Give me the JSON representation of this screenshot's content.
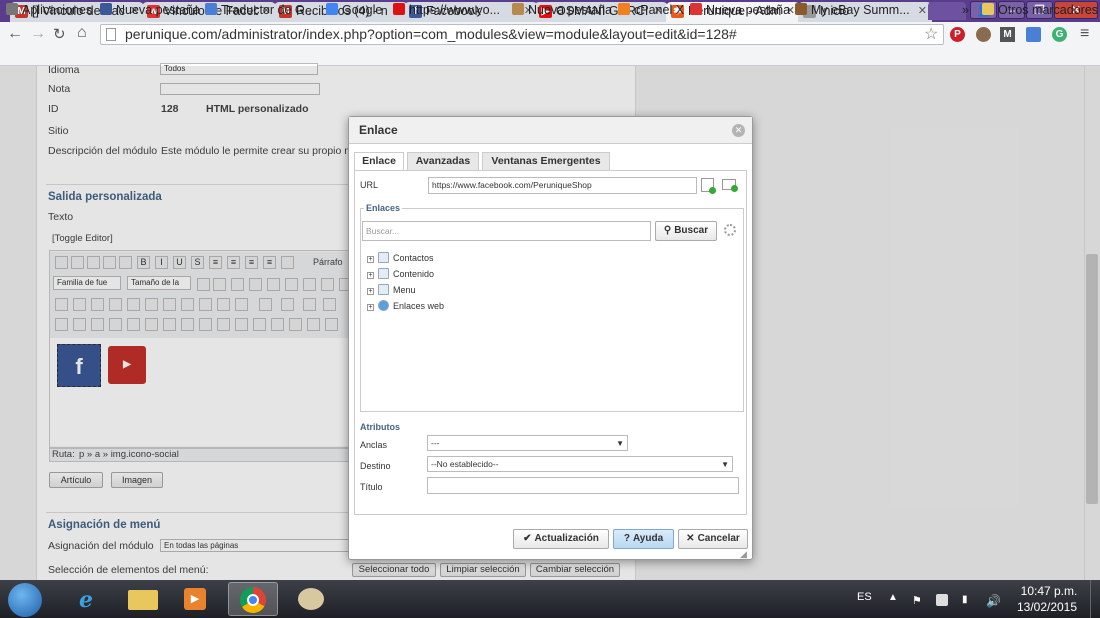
{
  "browser": {
    "tabs": [
      {
        "label": "[] Vinculo de Fac",
        "icon": "gmail-icon",
        "color": "#c3352b",
        "glyph": "M"
      },
      {
        "label": "Vinculo de Faceb",
        "icon": "wish-icon",
        "color": "#d33",
        "glyph": "w"
      },
      {
        "label": "Recibidos (4) - n",
        "icon": "gmail-icon",
        "color": "#c3352b",
        "glyph": "M"
      },
      {
        "label": "Facebook",
        "icon": "facebook-icon",
        "color": "#3b5998",
        "glyph": "f"
      },
      {
        "label": "OSMANI GARCI",
        "icon": "youtube-icon",
        "color": "#d11",
        "glyph": "▶"
      },
      {
        "label": "Perunique - Adm",
        "icon": "joomla-icon",
        "color": "#e65c1f",
        "glyph": "✱"
      },
      {
        "label": "Inicio",
        "icon": "page-icon",
        "color": "#999",
        "glyph": ""
      }
    ],
    "active_tab": 5,
    "url": "perunique.com/administrator/index.php?option=com_modules&view=module&layout=edit&id=128#",
    "bookmarks": [
      {
        "label": "Aplicaciones",
        "icon": "apps-icon",
        "color": "#777"
      },
      {
        "label": "Nueva pestaña",
        "icon": "facebook-icon",
        "color": "#3b5998"
      },
      {
        "label": "Traductor de G...",
        "icon": "translate-icon",
        "color": "#4a7fd6"
      },
      {
        "label": "Google",
        "icon": "google-icon",
        "color": "#4285f4"
      },
      {
        "label": "https://www.yo...",
        "icon": "youtube-icon",
        "color": "#d11"
      },
      {
        "label": "Nueva pestaña",
        "icon": "bowl-icon",
        "color": "#b58a4c"
      },
      {
        "label": "cPanel X",
        "icon": "cpanel-icon",
        "color": "#f08020"
      },
      {
        "label": "Nueva pestaña",
        "icon": "wish-icon",
        "color": "#d33"
      },
      {
        "label": "My eBay Summ...",
        "icon": "ebay-icon",
        "color": "#8a5a2a"
      }
    ],
    "bookmarks_more": "»",
    "other_bookmarks": "Otros marcadores"
  },
  "page": {
    "fields": [
      {
        "label": "Idioma",
        "value": "Todos"
      },
      {
        "label": "Nota",
        "value": ""
      },
      {
        "label": "ID",
        "value": "128",
        "extra": "HTML personalizado"
      },
      {
        "label": "Sitio",
        "value": ""
      },
      {
        "label": "Descripción del módulo",
        "value": "Este módulo le permite crear su propio m"
      }
    ],
    "custom_output_title": "Salida personalizada",
    "text_label": "Texto",
    "toggle_editor": "[Toggle Editor]",
    "format_select": "Párrafo",
    "font_family_select": "Familia de fue",
    "font_size_select": "Tamaño de la",
    "path_label": "Ruta:",
    "path_value": "p » a » img.icono-social",
    "article_button": "Artículo",
    "image_button": "Imagen",
    "menu_assignment_title": "Asignación de menú",
    "module_assignment_label": "Asignación del módulo",
    "module_assignment_value": "En todas las páginas",
    "menu_selection_label": "Selección de elementos del menú:",
    "select_all": "Seleccionar todo",
    "clear_selection": "Limpiar selección",
    "change_selection": "Cambiar selección",
    "facebook_color": "#3b5998",
    "youtube_color": "#c4302b"
  },
  "dialog": {
    "title": "Enlace",
    "tabs": [
      "Enlace",
      "Avanzadas",
      "Ventanas Emergentes"
    ],
    "active_tab": 0,
    "url_label": "URL",
    "url_value": "https://www.facebook.com/PeruniqueShop",
    "links_legend": "Enlaces",
    "search_placeholder": "Buscar...",
    "search_button": "Buscar",
    "tree_items": [
      "Contactos",
      "Contenido",
      "Menu",
      "Enlaces web"
    ],
    "attributes_legend": "Atributos",
    "anchors_label": "Anclas",
    "anchors_value": "---",
    "target_label": "Destino",
    "target_value": "--No establecido--",
    "title_label": "Título",
    "title_value": "",
    "update_button": "Actualización",
    "help_button": "Ayuda",
    "cancel_button": "Cancelar"
  },
  "taskbar": {
    "language": "ES",
    "time": "10:47 p.m.",
    "date": "13/02/2015"
  }
}
